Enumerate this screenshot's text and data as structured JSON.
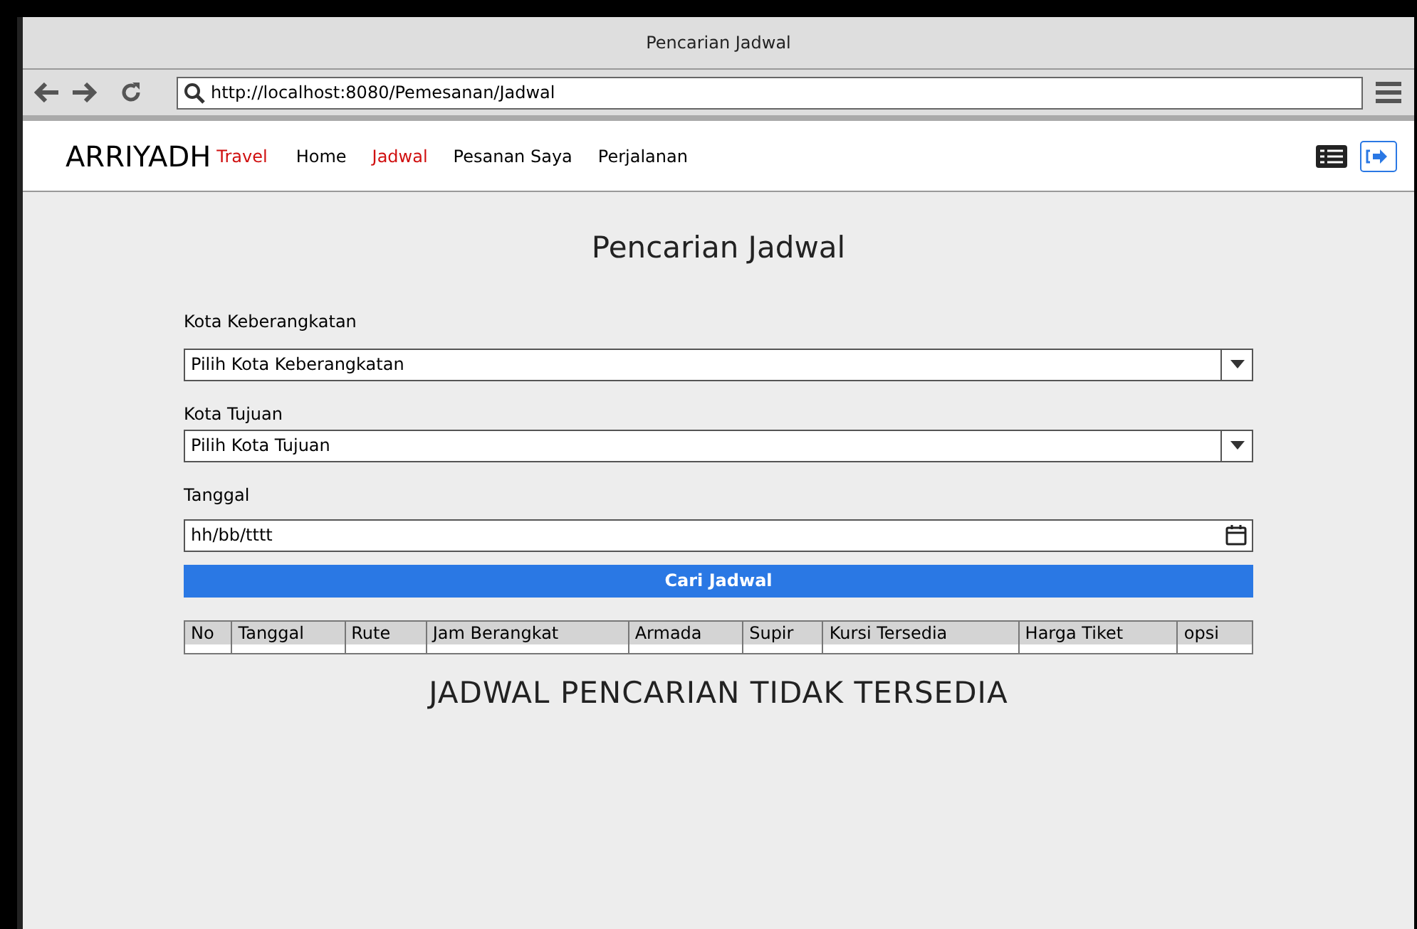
{
  "window": {
    "title": "Pencarian Jadwal"
  },
  "address_bar": {
    "url": "http://localhost:8080/Pemesanan/Jadwal"
  },
  "navbar": {
    "brand": "ARRIYADH",
    "brand_suffix": "Travel",
    "items": [
      {
        "label": "Home",
        "selected": false
      },
      {
        "label": "Jadwal",
        "selected": true
      },
      {
        "label": "Pesanan Saya",
        "selected": false
      },
      {
        "label": "Perjalanan",
        "selected": false
      }
    ]
  },
  "page": {
    "title": "Pencarian Jadwal",
    "fields": [
      {
        "kind": "select",
        "label": "Kota Keberangkatan",
        "value": "Pilih Kota Keberangkatan"
      },
      {
        "kind": "select",
        "label": "Kota Tujuan",
        "value": "Pilih Kota Tujuan"
      },
      {
        "kind": "date",
        "label": "Tanggal",
        "placeholder": "hh/bb/tttt"
      }
    ],
    "button": "Cari Jadwal",
    "table": {
      "columns": [
        "No",
        "Tanggal",
        "Rute",
        "Jam Berangkat",
        "Armada",
        "Supir",
        "Kursi Tersedia",
        "Harga Tiket",
        "opsi"
      ]
    },
    "empty_message": "JADWAL PENCARIAN TIDAK TERSEDIA"
  }
}
